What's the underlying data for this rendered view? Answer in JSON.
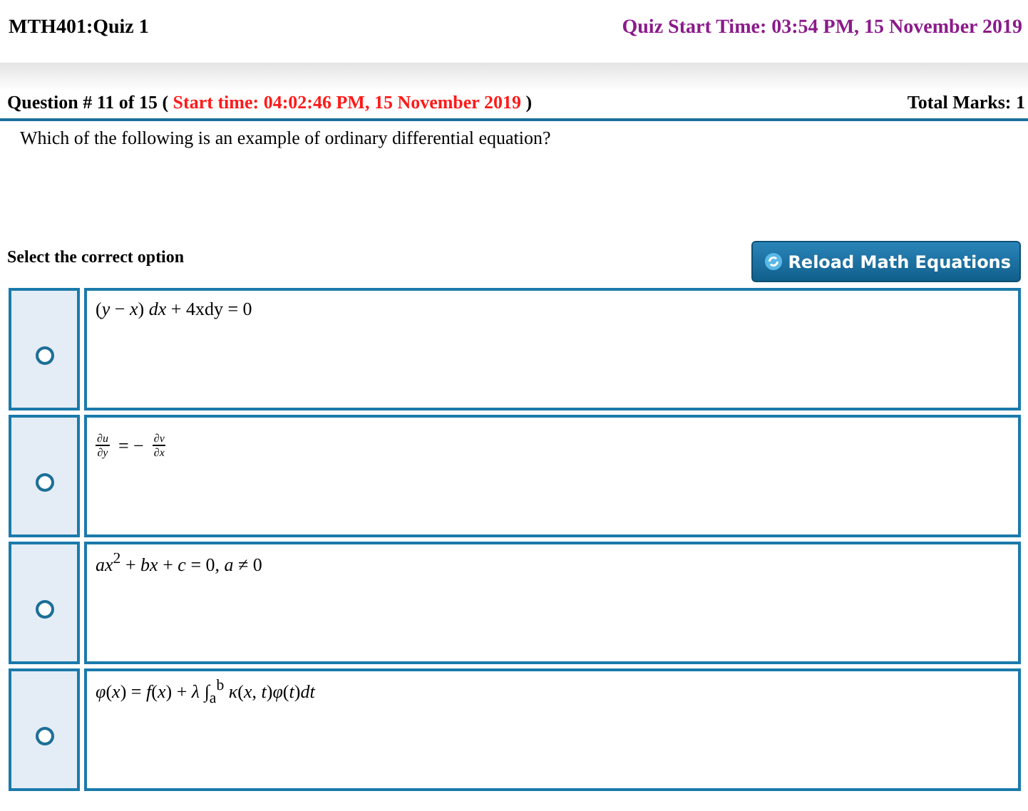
{
  "header": {
    "course": "MTH401:Quiz 1",
    "start_time": "Quiz Start Time: 03:54 PM, 15 November 2019"
  },
  "question": {
    "number": "Question # 11 of 15 (",
    "start": "Start time: 04:02:46 PM, 15 November 2019",
    "close": ")",
    "marks": "Total Marks: 1",
    "text": "Which of the following is an example of ordinary differential equation?"
  },
  "select_label": "Select the correct option",
  "reload_button": "Reload Math Equations",
  "options": [
    {
      "kind": "text",
      "text": "(*y* − *x*) *dx* + 4xdy = 0",
      "selected": false
    },
    {
      "kind": "fraction",
      "left": {
        "num": "∂u",
        "den": "∂y"
      },
      "middle": "= −",
      "right": {
        "num": "∂v",
        "den": "∂x"
      },
      "selected": false
    },
    {
      "kind": "text",
      "text": "*ax*$^{2}$ + *bx* + *c* = 0, *a* ≠ 0",
      "selected": false
    },
    {
      "kind": "text",
      "text": "*φ*(*x*) = *f*(*x*) + *λ* ∫$_{a}$$^{b}$ *κ*(*x*, *t*)*φ*(*t*)*dt*",
      "selected": false
    }
  ]
}
